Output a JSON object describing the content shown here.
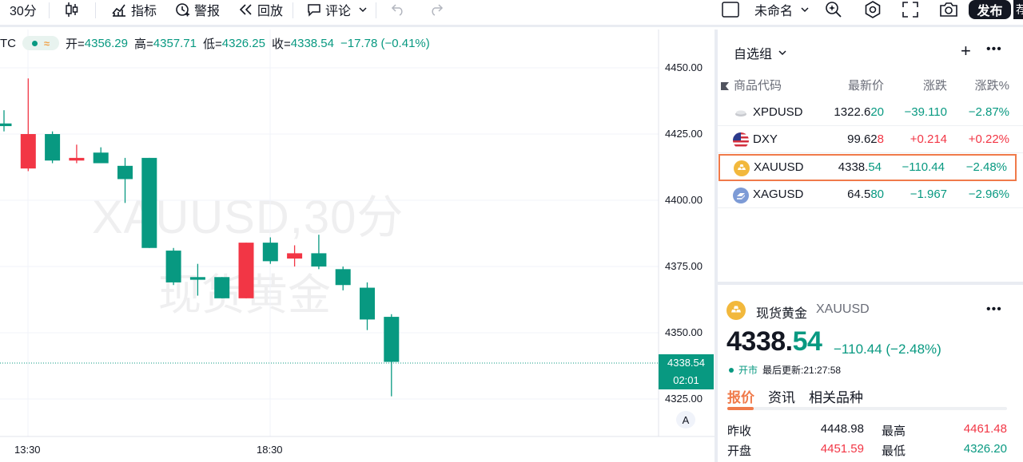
{
  "toolbar": {
    "interval": "30分",
    "indicators": "指标",
    "alerts": "警报",
    "replay": "回放",
    "comments": "评论",
    "layout_name": "未命名",
    "publish": "发布",
    "publish_cut": "荐"
  },
  "legend": {
    "symbol_fragment": "TC",
    "open_label": "开=",
    "open": "4356.29",
    "high_label": "高=",
    "high": "4357.71",
    "low_label": "低=",
    "low": "4326.25",
    "close_label": "收=",
    "close": "4338.54",
    "change": "−17.78 (−0.41%)"
  },
  "watermark": {
    "line1": "XAUUSD,30分",
    "line2": "现货黄金"
  },
  "price_axis": {
    "labels": [
      "4450.00",
      "4425.00",
      "4400.00",
      "4375.00",
      "4350.00",
      "4325.00"
    ],
    "current_price": "4338.54",
    "countdown": "02:01"
  },
  "time_axis": {
    "labels": [
      "13:30",
      "18:30"
    ],
    "auto": "A"
  },
  "chart_data": {
    "type": "candlestick",
    "symbol": "XAUUSD",
    "interval": "30分",
    "ylim": [
      4320,
      4455
    ],
    "last_price": 4338.54,
    "colors": {
      "up": "#f23645",
      "down": "#089981"
    },
    "candles": [
      {
        "o": 4429,
        "h": 4434,
        "l": 4426,
        "c": 4428
      },
      {
        "o": 4412,
        "h": 4446,
        "l": 4411,
        "c": 4425
      },
      {
        "o": 4425,
        "h": 4426,
        "l": 4414,
        "c": 4415
      },
      {
        "o": 4415,
        "h": 4421,
        "l": 4414,
        "c": 4416
      },
      {
        "o": 4418,
        "h": 4420,
        "l": 4414,
        "c": 4414
      },
      {
        "o": 4413,
        "h": 4416,
        "l": 4399,
        "c": 4408
      },
      {
        "o": 4416,
        "h": 4416,
        "l": 4382,
        "c": 4382
      },
      {
        "o": 4381,
        "h": 4382,
        "l": 4368,
        "c": 4369
      },
      {
        "o": 4371,
        "h": 4376,
        "l": 4364,
        "c": 4370
      },
      {
        "o": 4371,
        "h": 4371,
        "l": 4363,
        "c": 4363
      },
      {
        "o": 4363,
        "h": 4384,
        "l": 4363,
        "c": 4384
      },
      {
        "o": 4384,
        "h": 4386,
        "l": 4376,
        "c": 4377
      },
      {
        "o": 4378,
        "h": 4383,
        "l": 4375,
        "c": 4380
      },
      {
        "o": 4380,
        "h": 4387,
        "l": 4374,
        "c": 4375
      },
      {
        "o": 4374,
        "h": 4375,
        "l": 4366,
        "c": 4368
      },
      {
        "o": 4367,
        "h": 4369,
        "l": 4351,
        "c": 4355
      },
      {
        "o": 4356,
        "h": 4357,
        "l": 4326,
        "c": 4339
      }
    ]
  },
  "watchlist": {
    "title": "自选组",
    "add": "+",
    "more": "•••",
    "headers": {
      "symbol": "商品代码",
      "last": "最新价",
      "change": "涨跌",
      "change_pct": "涨跌%"
    },
    "rows": [
      {
        "symbol": "XPDUSD",
        "last_main": "1322.6",
        "last_tail": "20",
        "change": "−39.110",
        "pct": "−2.87%",
        "dir": "down",
        "logo": "palladium-bar-icon"
      },
      {
        "symbol": "DXY",
        "last_main": "99.62",
        "last_tail": "8",
        "change": "+0.214",
        "pct": "+0.22%",
        "dir": "up",
        "logo": "us-flag-icon"
      },
      {
        "symbol": "XAUUSD",
        "last_main": "4338.",
        "last_tail": "54",
        "change": "−110.44",
        "pct": "−2.48%",
        "dir": "down",
        "logo": "gold-bar-icon"
      },
      {
        "symbol": "XAGUSD",
        "last_main": "64.5",
        "last_tail": "80",
        "change": "−1.967",
        "pct": "−2.96%",
        "dir": "down",
        "logo": "silver-bar-icon"
      }
    ]
  },
  "details": {
    "name": "现货黄金",
    "symbol": "XAUUSD",
    "more": "•••",
    "price_main": "4338.",
    "price_dec": "54",
    "change": "−110.44 (−2.48%)",
    "market_status": "开市",
    "last_update": "最后更新:21:27:58",
    "tabs": [
      "报价",
      "资讯",
      "相关品种"
    ],
    "stats": {
      "prev_close_label": "昨收",
      "prev_close": "4448.98",
      "high_label": "最高",
      "high": "4461.48",
      "open_label": "开盘",
      "open": "4451.59",
      "low_label": "最低",
      "low": "4326.20"
    }
  }
}
